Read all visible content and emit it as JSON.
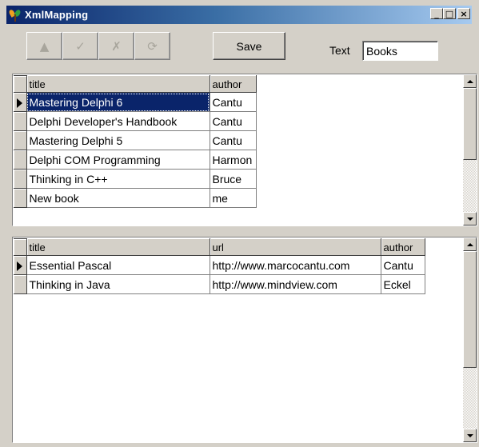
{
  "window": {
    "title": "XmlMapping",
    "minimize_label": "_",
    "maximize_label": "□",
    "close_label": "×"
  },
  "toolbar": {
    "nav_buttons": [
      {
        "icon": "insert-icon",
        "glyph": "▲"
      },
      {
        "icon": "post-icon",
        "glyph": "✓"
      },
      {
        "icon": "cancel-icon",
        "glyph": "✗"
      },
      {
        "icon": "refresh-icon",
        "glyph": "⟳"
      }
    ],
    "save_label": "Save",
    "text_label": "Text",
    "text_value": "Books"
  },
  "grid_books": {
    "columns": [
      "title",
      "author"
    ],
    "rows": [
      [
        "Mastering Delphi 6",
        "Cantu"
      ],
      [
        "Delphi Developer's Handbook",
        "Cantu"
      ],
      [
        "Mastering Delphi 5",
        "Cantu"
      ],
      [
        "Delphi COM Programming",
        "Harmon"
      ],
      [
        "Thinking in C++",
        "Bruce"
      ],
      [
        "New book",
        "me"
      ]
    ],
    "selected_row": 0
  },
  "grid_ebooks": {
    "columns": [
      "title",
      "url",
      "author"
    ],
    "rows": [
      [
        "Essential Pascal",
        "http://www.marcocantu.com",
        "Cantu"
      ],
      [
        "Thinking in Java",
        "http://www.mindview.com",
        "Eckel"
      ]
    ],
    "selected_row": 0
  },
  "colors": {
    "titlebar_start": "#0a246a",
    "titlebar_end": "#a6caf0",
    "face": "#d4d0c8",
    "selection": "#0a246a"
  }
}
